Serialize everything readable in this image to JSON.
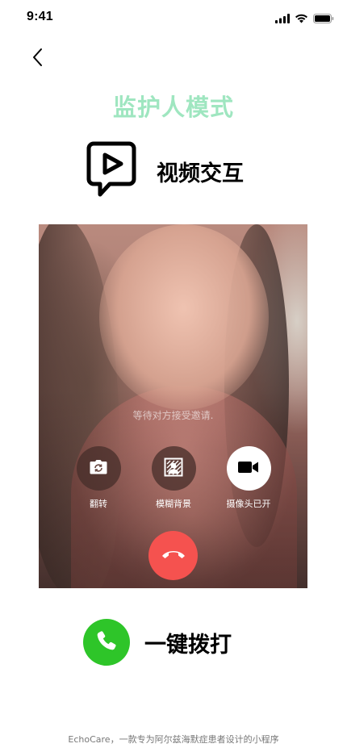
{
  "status_bar": {
    "time": "9:41",
    "icons": [
      "signal-icon",
      "wifi-icon",
      "battery-icon"
    ]
  },
  "header": {
    "back_icon": "chevron-left-icon",
    "title": "监护人模式",
    "title_color": "#9fe6c0"
  },
  "feature": {
    "icon": "video-chat-icon",
    "label": "视频交互"
  },
  "video_call": {
    "waiting_text": "等待对方接受邀请.",
    "controls": [
      {
        "icon": "flip-camera-icon",
        "label": "翻转"
      },
      {
        "icon": "blur-background-icon",
        "label": "模糊背景"
      },
      {
        "icon": "camera-on-icon",
        "label": "摄像头已开"
      }
    ],
    "hangup_icon": "hang-up-icon",
    "hangup_color": "#f5524f"
  },
  "dial": {
    "icon": "phone-icon",
    "label": "一键拨打",
    "color": "#2ec529"
  },
  "footer": {
    "text": "EchoCare，一款专为阿尔兹海默症患者设计的小程序"
  }
}
